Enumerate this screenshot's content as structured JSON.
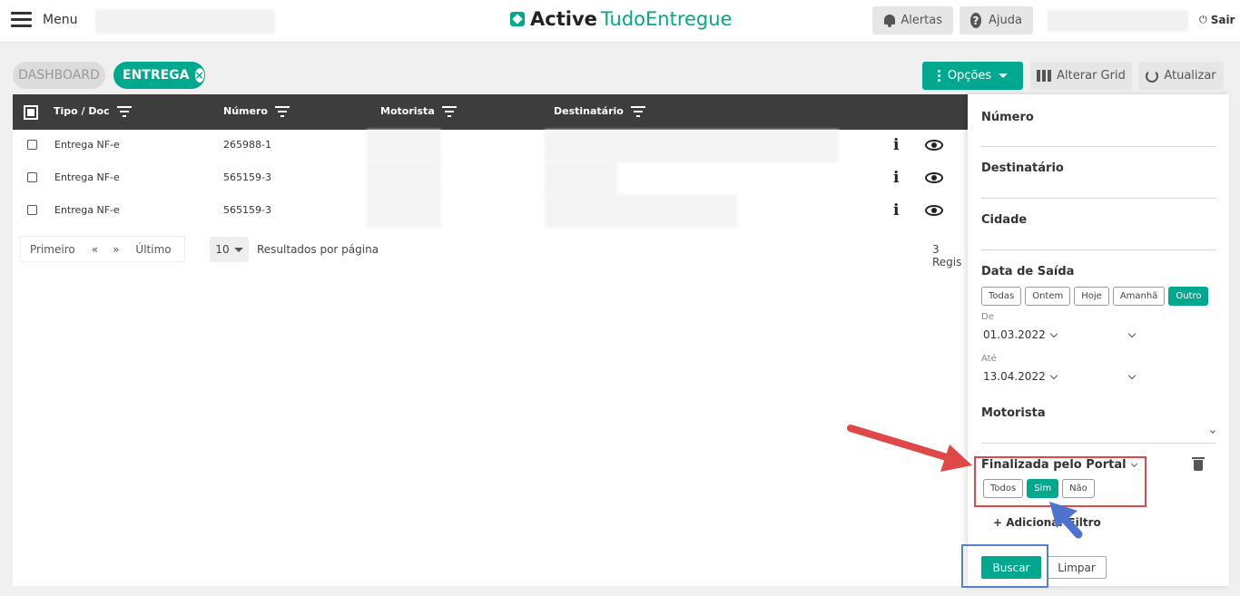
{
  "header": {
    "menu_label": "Menu",
    "brand_active": "Active",
    "brand_tudo": "TudoEntregue",
    "alerts_label": "Alertas",
    "help_label": "Ajuda",
    "help_glyph": "?",
    "logout_label": "Sair",
    "logout_glyph": "⏻"
  },
  "tabs": [
    {
      "label": "DASHBOARD",
      "active": false
    },
    {
      "label": "ENTREGA",
      "active": true
    }
  ],
  "toolbar": {
    "options_label": "Opções",
    "grid_label": "Alterar Grid",
    "refresh_label": "Atualizar"
  },
  "table": {
    "columns": [
      "Tipo / Doc",
      "Número",
      "Motorista",
      "Destinatário"
    ],
    "rows": [
      {
        "tipo": "Entrega NF-e",
        "numero": "265988-1"
      },
      {
        "tipo": "Entrega NF-e",
        "numero": "565159-3"
      },
      {
        "tipo": "Entrega NF-e",
        "numero": "565159-3"
      }
    ],
    "info_glyph": "i"
  },
  "pagination": {
    "first": "Primeiro",
    "prev": "«",
    "next": "»",
    "last": "Último",
    "page_size": "10",
    "page_size_label": "Resultados por página",
    "records": "3 Regis"
  },
  "filters": {
    "numero": "Número",
    "destinatario": "Destinatário",
    "cidade": "Cidade",
    "data_saida": "Data de Saída",
    "date_chips": [
      "Todas",
      "Ontem",
      "Hoje",
      "Amanhã",
      "Outro"
    ],
    "date_active": "Outro",
    "de_label": "De",
    "de_value": "01.03.2022",
    "ate_label": "Até",
    "ate_value": "13.04.2022",
    "motorista": "Motorista",
    "finalizada": "Finalizada pelo Portal",
    "finalizada_chips": [
      "Todos",
      "Sim",
      "Não"
    ],
    "finalizada_active": "Sim",
    "add_filter": "+ Adicionar Filtro",
    "buscar": "Buscar",
    "limpar": "Limpar"
  },
  "colors": {
    "accent": "#00a88e",
    "header_dark": "#3d3d3d",
    "annotation_red": "#e04848",
    "annotation_blue": "#5b7fd0"
  }
}
